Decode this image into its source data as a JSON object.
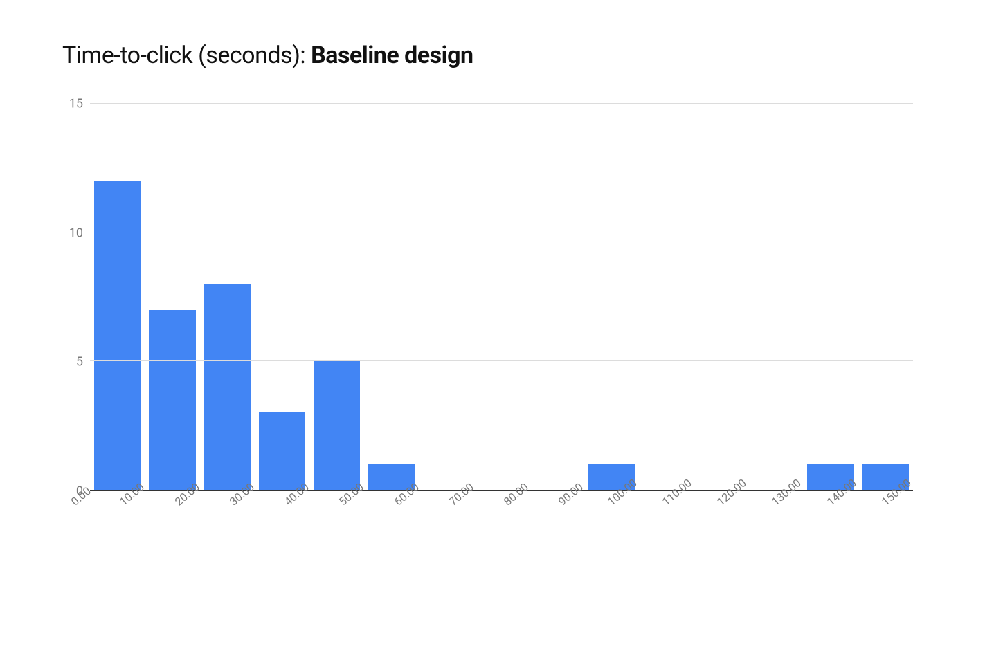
{
  "chart_data": {
    "type": "bar",
    "title_light": "Time-to-click (seconds): ",
    "title_bold": "Baseline design",
    "xlabel": "",
    "ylabel": "",
    "ylim": [
      0,
      15
    ],
    "y_ticks": [
      0,
      5,
      10,
      15
    ],
    "bar_color": "#4285f4",
    "x_edges": [
      "0.00",
      "10.00",
      "20.00",
      "30.00",
      "40.00",
      "50.00",
      "60.00",
      "70.00",
      "80.00",
      "90.00",
      "100.00",
      "110.00",
      "120.00",
      "130.00",
      "140.00",
      "150.00"
    ],
    "categories": [
      "0-10",
      "10-20",
      "20-30",
      "30-40",
      "40-50",
      "50-60",
      "60-70",
      "70-80",
      "80-90",
      "90-100",
      "100-110",
      "110-120",
      "120-130",
      "130-140",
      "140-150"
    ],
    "values": [
      12,
      7,
      8,
      3,
      5,
      1,
      0,
      0,
      0,
      1,
      0,
      0,
      0,
      1,
      1
    ]
  }
}
